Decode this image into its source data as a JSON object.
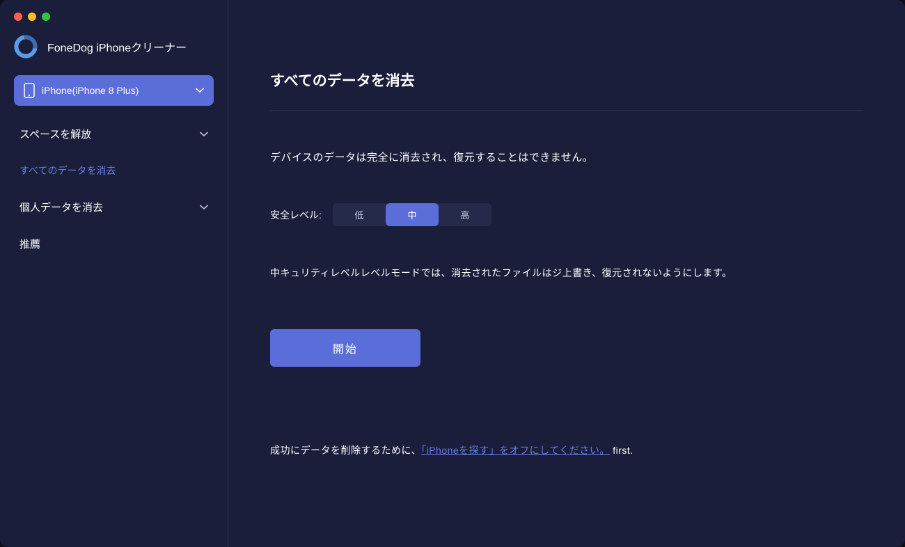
{
  "app": {
    "title": "FoneDog iPhoneクリーナー"
  },
  "device": {
    "name": "iPhone(iPhone 8 Plus)"
  },
  "sidebar": {
    "items": [
      {
        "label": "スペースを解放",
        "has_chevron": true
      },
      {
        "label": "すべてのデータを消去",
        "has_chevron": false,
        "active": true
      },
      {
        "label": "個人データを消去",
        "has_chevron": true
      },
      {
        "label": "推薦",
        "has_chevron": false
      }
    ]
  },
  "main": {
    "title": "すべてのデータを消去",
    "warning": "デバイスのデータは完全に消去され、復元することはできません。",
    "security_label": "安全レベル:",
    "security_options": [
      "低",
      "中",
      "高"
    ],
    "security_selected": "中",
    "security_desc": "中キュリティレベルレベルモードでは、消去されたファイルはジ上書き、復元されないようにします。",
    "start_button": "開始",
    "footer_prefix": "成功にデータを削除するために、",
    "footer_link": "「iPhoneを探す」をオフにしてください。",
    "footer_suffix": " first."
  }
}
